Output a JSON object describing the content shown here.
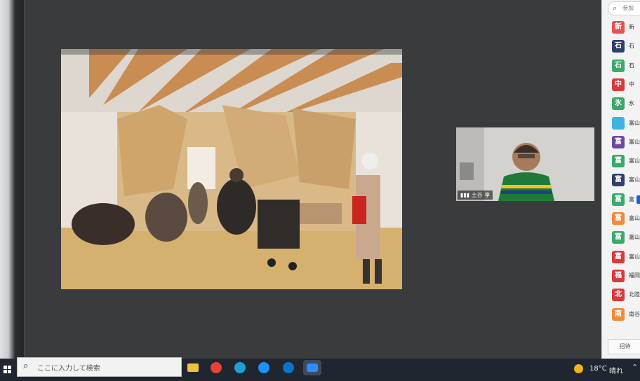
{
  "participants": {
    "search_placeholder": "参加",
    "items": [
      {
        "avatar": "新",
        "name": "新",
        "color": "#e25353"
      },
      {
        "avatar": "石",
        "name": "石",
        "color": "#2f3e6b"
      },
      {
        "avatar": "石",
        "name": "石",
        "color": "#3aa96b"
      },
      {
        "avatar": "中",
        "name": "中",
        "color": "#d93a3a"
      },
      {
        "avatar": "氷",
        "name": "氷",
        "color": "#3aa96b"
      },
      {
        "avatar": "",
        "name": "富山",
        "color": "#3cb4e0"
      },
      {
        "avatar": "富",
        "name": "富山",
        "color": "#6b4a9b"
      },
      {
        "avatar": "富",
        "name": "富山",
        "color": "#3aa96b"
      },
      {
        "avatar": "富",
        "name": "富山",
        "color": "#2f3e6b"
      },
      {
        "avatar": "富",
        "name": "富",
        "color": "#3aa96b"
      },
      {
        "avatar": "富",
        "name": "富山",
        "color": "#f08a3c"
      },
      {
        "avatar": "富",
        "name": "富山",
        "color": "#3aa96b"
      },
      {
        "avatar": "富",
        "name": "富山",
        "color": "#d93a3a"
      },
      {
        "avatar": "福",
        "name": "福岡",
        "color": "#d93a3a"
      },
      {
        "avatar": "北",
        "name": "北陸",
        "color": "#d93a3a"
      },
      {
        "avatar": "南",
        "name": "南谷",
        "color": "#f08a3c"
      }
    ],
    "invite_label": "招待"
  },
  "video": {
    "name": "土谷 享"
  },
  "taskbar": {
    "search_placeholder": "ここに入力して検索",
    "apps": [
      {
        "icon": "file-explorer-icon",
        "color": "#f0c040"
      },
      {
        "icon": "chrome-icon",
        "color": "#e94235"
      },
      {
        "icon": "edge-icon",
        "color": "#1ea0d5"
      },
      {
        "icon": "internet-explorer-icon",
        "color": "#1e90ff"
      },
      {
        "icon": "edge-dev-icon",
        "color": "#0a74c8"
      },
      {
        "icon": "zoom-icon",
        "color": "#2d8cff"
      }
    ],
    "temperature": "18°C",
    "weather": "晴れ"
  }
}
